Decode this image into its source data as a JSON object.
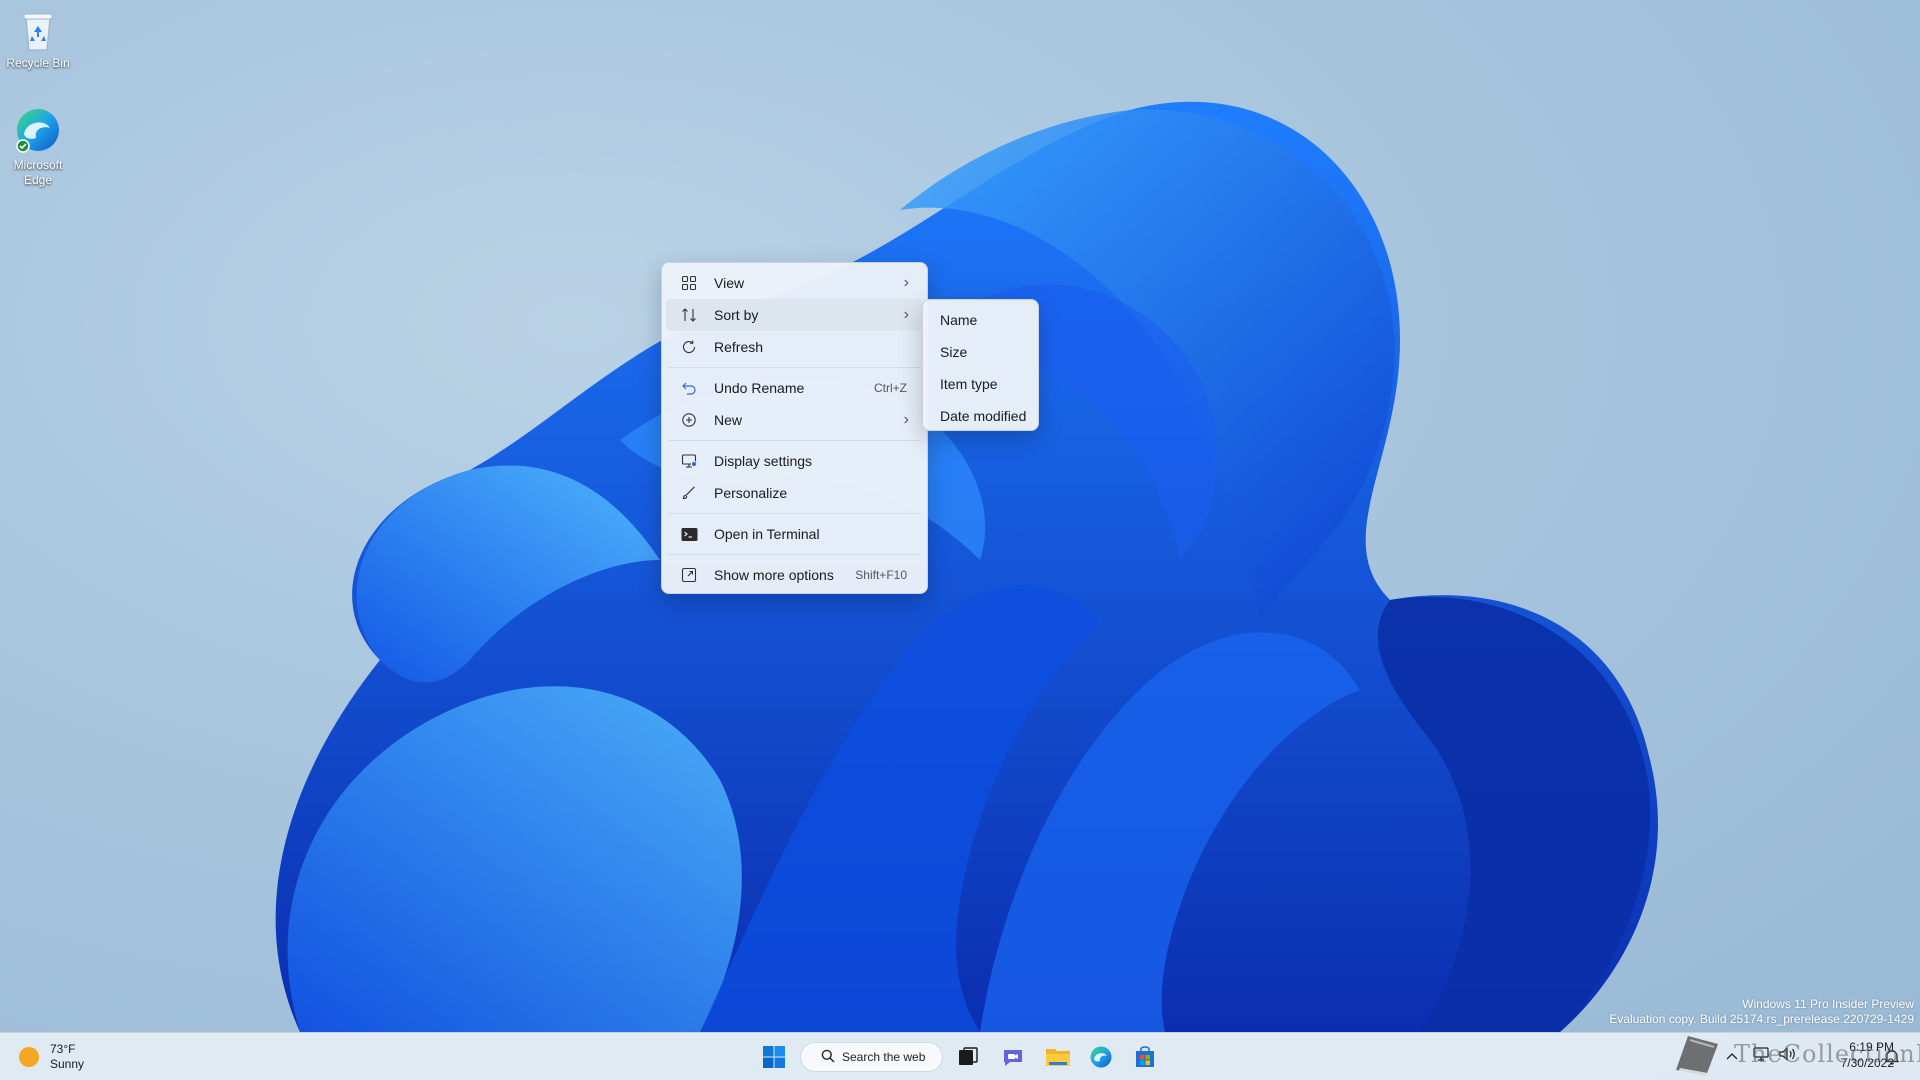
{
  "desktop": {
    "icons": [
      {
        "label": "Recycle Bin"
      },
      {
        "label": "Microsoft Edge"
      }
    ]
  },
  "context_menu": {
    "items": [
      {
        "label": "View",
        "icon": "grid-icon",
        "submenu": true
      },
      {
        "label": "Sort by",
        "icon": "sort-icon",
        "submenu": true,
        "hovered": true
      },
      {
        "label": "Refresh",
        "icon": "refresh-icon"
      },
      {
        "label": "Undo Rename",
        "icon": "undo-icon",
        "shortcut": "Ctrl+Z"
      },
      {
        "label": "New",
        "icon": "plus-circle-icon",
        "submenu": true
      },
      {
        "label": "Display settings",
        "icon": "display-icon"
      },
      {
        "label": "Personalize",
        "icon": "brush-icon"
      },
      {
        "label": "Open in Terminal",
        "icon": "terminal-icon"
      },
      {
        "label": "Show more options",
        "icon": "expand-icon",
        "shortcut": "Shift+F10"
      }
    ]
  },
  "sort_submenu": {
    "items": [
      "Name",
      "Size",
      "Item type",
      "Date modified"
    ]
  },
  "taskbar": {
    "weather_temp": "73°F",
    "weather_desc": "Sunny",
    "search_label": "Search the web",
    "time": "6:19 PM",
    "date": "7/30/2022"
  },
  "watermark": {
    "line1": "Windows 11 Pro Insider Preview",
    "line2": "Evaluation copy. Build 25174.rs_prerelease.220729-1429"
  },
  "logo": {
    "text": "TheCollectionBook"
  },
  "colors": {
    "accent": "#0067c0",
    "menu_bg": "#ecf2f9",
    "taskbar_bg": "#e2ebf4"
  }
}
